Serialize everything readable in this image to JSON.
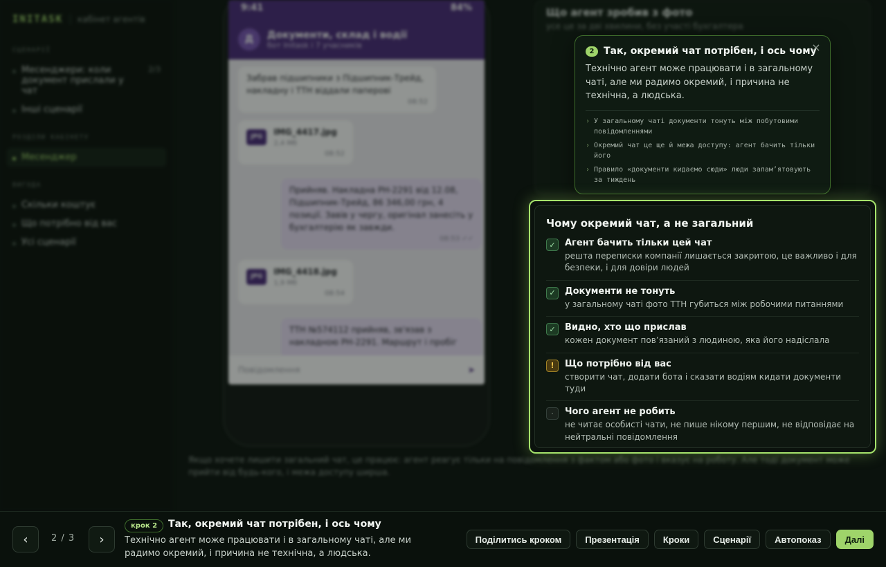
{
  "sidebar": {
    "brand": "INITASK",
    "brand_sub": "кабінет агентів",
    "sections": [
      {
        "title": "СЦЕНАРІЇ",
        "items": [
          {
            "label": "Месенджери: коли документ прислали у чат",
            "count": "2/3"
          },
          {
            "label": "Інші сценарії",
            "count": ""
          }
        ]
      },
      {
        "title": "РОЗДІЛИ КАБІНЕТУ",
        "items": [
          {
            "label": "Месенджер",
            "count": ""
          }
        ]
      },
      {
        "title": "ВИГОДА",
        "items": [
          {
            "label": "Скільки коштує",
            "count": ""
          },
          {
            "label": "Що потрібно від вас",
            "count": ""
          },
          {
            "label": "Усі сценарії",
            "count": ""
          }
        ]
      }
    ]
  },
  "phone": {
    "time": "9:41",
    "battery": "84%",
    "chat_avatar": "Д",
    "chat_title": "Документи, склад і водії",
    "chat_sub": "бот Initask і 7 учасників",
    "messages": [
      {
        "text": "Забрав підшипники з Підшипник-Трейд, накладну і ТТН віддали паперові",
        "time": "08:52"
      },
      {
        "file": "IMG_4417.jpg",
        "size": "2,4 Мб",
        "badge": "JPG",
        "time": "08:52"
      },
      {
        "text": "Прийняв. Накладна РН-2291 від 12.08, Підшипник-Трейд, 86 346,00 грн, 4 позиції. Завів у чергу, оригінал занесіть у бухгалтерію як завжди.",
        "time": "08:53 ✓✓"
      },
      {
        "file": "IMG_4418.jpg",
        "size": "1,9 Мб",
        "badge": "JPG",
        "time": "08:54"
      },
      {
        "text": "ТТН №574112 прийняв, зв'язав з накладною РН-2291. Маршрут і пробіг"
      }
    ],
    "composer_placeholder": "Повідомлення",
    "send_icon": "➤"
  },
  "caption": "Якщо хочете лишити загальний чат, це працює: агент реагує тільки на повідомлення з фактом або фото і вказує на роботу. Але тоді документ може прийти від будь-кого, і межа доступу ширша.",
  "bg_panel": {
    "title": "Що агент зробив з фото",
    "subtitle": "усе це за дві хвилини, без участі бухгалтера"
  },
  "tooltip": {
    "step": "2",
    "title": "Так, окремий чат потрібен, і ось чому",
    "text": "Технічно агент може працювати і в загальному чаті, але ми радимо окремий, і причина не технічна, а людська.",
    "bullets": [
      "У загальному чаті документи тонуть між побутовими повідомленнями",
      "Окремий чат це ще й межа доступу: агент бачить тільки його",
      "Правило «документи кидаємо сюди» люди запам’ятовують за тиждень"
    ]
  },
  "panel": {
    "title": "Чому окремий чат, а не загальний",
    "rows": [
      {
        "status": "ok",
        "icon": "✓",
        "title": "Агент бачить тільки цей чат",
        "desc": "решта переписки компанії лишається закритою, це важливо і для безпеки, і для довіри людей"
      },
      {
        "status": "ok",
        "icon": "✓",
        "title": "Документи не тонуть",
        "desc": "у загальному чаті фото ТТН губиться між робочими питаннями"
      },
      {
        "status": "ok",
        "icon": "✓",
        "title": "Видно, хто що прислав",
        "desc": "кожен документ пов’язаний з людиною, яка його надіслала"
      },
      {
        "status": "warn",
        "icon": "!",
        "title": "Що потрібно від вас",
        "desc": "створити чат, додати бота і сказати водіям кидати документи туди"
      },
      {
        "status": "neutral",
        "icon": "·",
        "title": "Чого агент не робить",
        "desc": "не читає особисті чати, не пише нікому першим, не відповідає на нейтральні повідомлення"
      }
    ]
  },
  "bottom": {
    "prev": "‹",
    "next": "›",
    "counter": "2 / 3",
    "badge": "крок 2",
    "title": "Так, окремий чат потрібен, і ось чому",
    "text": "Технічно агент може працювати і в загальному чаті, але ми радимо окремий, і причина не технічна, а людська.",
    "actions": [
      "Поділитись кроком",
      "Презентація",
      "Кроки",
      "Сценарії",
      "Автопоказ"
    ],
    "primary": "Далі"
  }
}
